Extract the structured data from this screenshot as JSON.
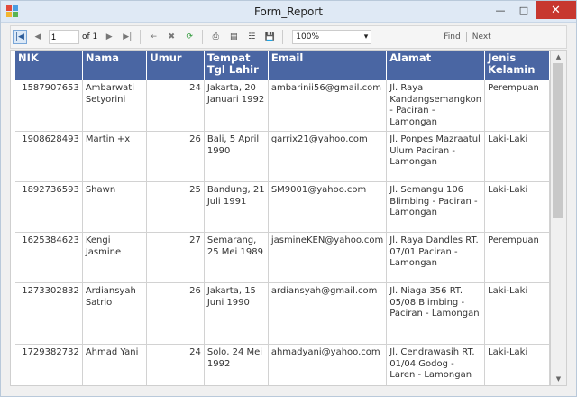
{
  "window": {
    "title": "Form_Report"
  },
  "toolbar": {
    "page_value": "1",
    "of_label": "of 1",
    "zoom": "100%",
    "find_label": "Find",
    "next_label": "Next"
  },
  "table": {
    "headers": [
      "NIK",
      "Nama",
      "Umur",
      "Tempat Tgl Lahir",
      "Email",
      "Alamat",
      "Jenis Kelamin"
    ],
    "rows": [
      {
        "nik": "1587907653",
        "nama": "Ambarwati Setyorini",
        "umur": "24",
        "ttl": "Jakarta, 20 Januari 1992",
        "email": "ambarinii56@gmail.com",
        "alamat": "Jl. Raya Kandangsemangkon - Paciran - Lamongan",
        "jk": "Perempuan"
      },
      {
        "nik": "1908628493",
        "nama": "Martin +x",
        "umur": "26",
        "ttl": "Bali, 5 April 1990",
        "email": "garrix21@yahoo.com",
        "alamat": "Jl. Ponpes Mazraatul Ulum Paciran - Lamongan",
        "jk": "Laki-Laki"
      },
      {
        "nik": "1892736593",
        "nama": "Shawn",
        "umur": "25",
        "ttl": "Bandung, 21 Juli 1991",
        "email": "SM9001@yahoo.com",
        "alamat": "Jl. Semangu 106 Blimbing - Paciran - Lamongan",
        "jk": "Laki-Laki"
      },
      {
        "nik": "1625384623",
        "nama": "Kengi Jasmine",
        "umur": "27",
        "ttl": "Semarang, 25 Mei 1989",
        "email": "jasmineKEN@yahoo.com",
        "alamat": "Jl. Raya Dandles RT. 07/01 Paciran - Lamongan",
        "jk": "Perempuan"
      },
      {
        "nik": "1273302832",
        "nama": "Ardiansyah Satrio",
        "umur": "26",
        "ttl": "Jakarta, 15 Juni 1990",
        "email": "ardiansyah@gmail.com",
        "alamat": "Jl. Niaga 356 RT. 05/08 Blimbing - Paciran - Lamongan",
        "jk": "Laki-Laki"
      },
      {
        "nik": "1729382732",
        "nama": "Ahmad Yani",
        "umur": "24",
        "ttl": "Solo, 24 Mei 1992",
        "email": "ahmadyani@yahoo.com",
        "alamat": "Jl. Cendrawasih RT. 01/04 Godog - Laren - Lamongan",
        "jk": "Laki-Laki"
      }
    ]
  }
}
